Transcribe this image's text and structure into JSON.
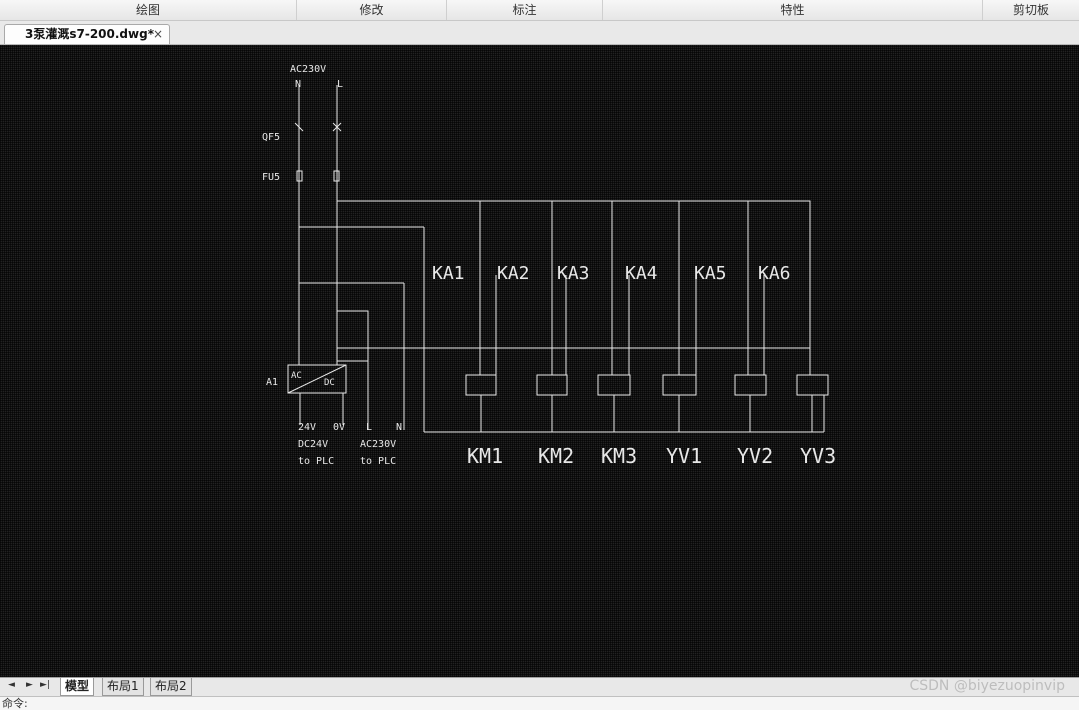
{
  "ribbon": {
    "panels": [
      "绘图",
      "修改",
      "标注",
      "特性",
      "剪切板"
    ]
  },
  "tabs": {
    "file_name": "3泵灌溉s7-200.dwg*",
    "close_glyph": "×"
  },
  "drawing": {
    "supply_label": "AC230V",
    "n_label": "N",
    "l_label": "L",
    "qf_label": "QF5",
    "fu_label": "FU5",
    "a_label": "A1",
    "ac_label": "AC",
    "dc_label": "DC",
    "out24_label": "24V",
    "out0_label": "0V",
    "outl_label": "L",
    "outn_label": "N",
    "dc_plc_1": "DC24V",
    "dc_plc_2": "to PLC",
    "ac_plc_1": "AC230V",
    "ac_plc_2": "to PLC",
    "relays": [
      "KA1",
      "KA2",
      "KA3",
      "KA4",
      "KA5",
      "KA6"
    ],
    "loads": [
      "KM1",
      "KM2",
      "KM3",
      "YV1",
      "YV2",
      "YV3"
    ]
  },
  "layout_tabs": {
    "nav": [
      "◄",
      "►",
      "►|"
    ],
    "model": "模型",
    "layout1": "布局1",
    "layout2": "布局2"
  },
  "watermark": "CSDN @biyezuopinvip",
  "command": {
    "prompt": "命令:"
  }
}
